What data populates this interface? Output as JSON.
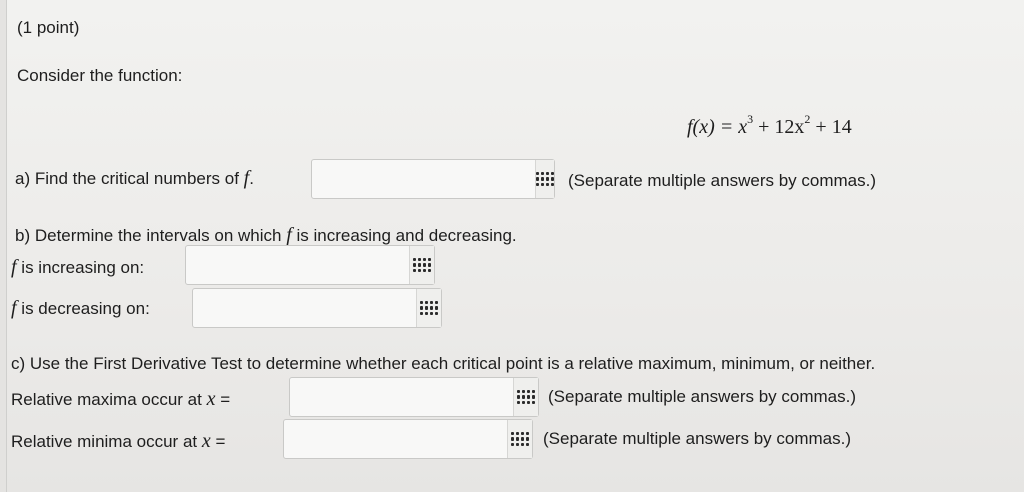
{
  "header": {
    "points": "(1 point)"
  },
  "intro": "Consider the function:",
  "function": {
    "lhs": "f(x) = x",
    "exp1": "3",
    "mid": " + 12x",
    "exp2": "2",
    "tail": " + 14"
  },
  "part_a": {
    "label_pre": "a) Find the critical numbers of ",
    "label_var": "f",
    "label_post": ".",
    "hint": "(Separate multiple answers by commas.)",
    "value": ""
  },
  "part_b": {
    "question_pre": "b) Determine the intervals on which ",
    "question_var": "f",
    "question_post": " is increasing and decreasing.",
    "inc_var": "f",
    "inc_label": " is increasing on:",
    "inc_value": "",
    "dec_var": "f",
    "dec_label": " is decreasing on:",
    "dec_value": ""
  },
  "part_c": {
    "question": "c) Use the First Derivative Test to determine whether each critical point is a relative maximum, minimum, or neither.",
    "max_label": "Relative maxima occur at ",
    "max_var": "x",
    "max_eq": " =",
    "max_hint": "(Separate multiple answers by commas.)",
    "max_value": "",
    "min_label": "Relative minima occur at ",
    "min_var": "x",
    "min_eq": " =",
    "min_hint": "(Separate multiple answers by commas.)",
    "min_value": ""
  },
  "icons": {
    "palette": "grid-palette-icon"
  }
}
